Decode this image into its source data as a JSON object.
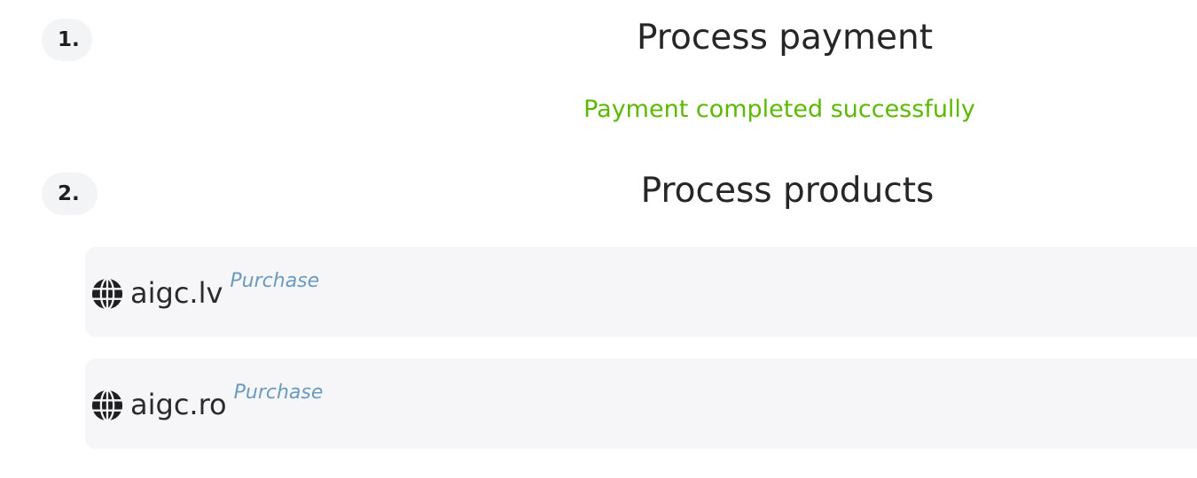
{
  "steps": [
    {
      "number": "1.",
      "title": "Process payment",
      "status": "Payment completed successfully"
    },
    {
      "number": "2.",
      "title": "Process products",
      "products": [
        {
          "domain": "aigc.lv",
          "action": "Purchase"
        },
        {
          "domain": "aigc.ro",
          "action": "Purchase"
        }
      ]
    }
  ],
  "colors": {
    "success": "#5cb800",
    "link": "#6a9bbf",
    "card_bg": "#f6f6f8",
    "badge_bg": "#f3f4f6"
  },
  "icons": {
    "product": "globe-icon"
  }
}
